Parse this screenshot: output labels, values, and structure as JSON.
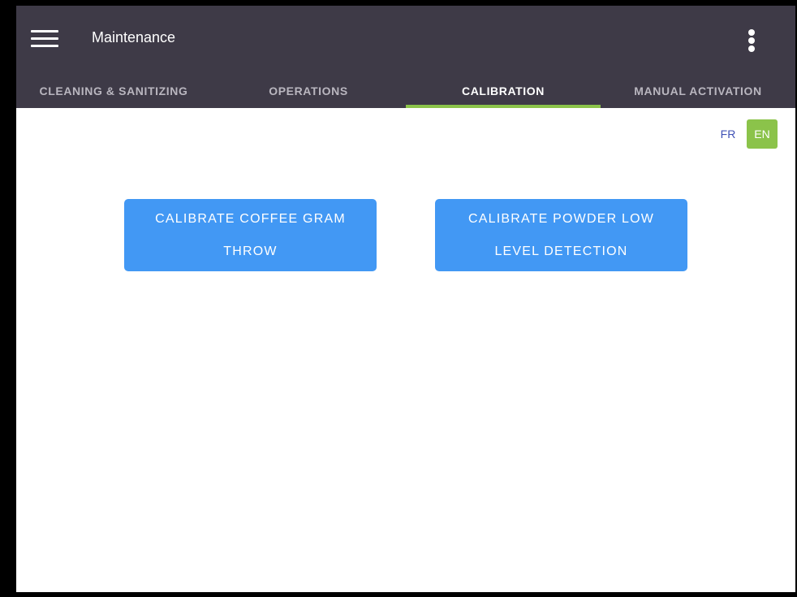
{
  "app": {
    "title": "Maintenance"
  },
  "tabs": [
    {
      "label": "CLEANING & SANITIZING",
      "active": false
    },
    {
      "label": "OPERATIONS",
      "active": false
    },
    {
      "label": "CALIBRATION",
      "active": true
    },
    {
      "label": "MANUAL ACTIVATION",
      "active": false
    }
  ],
  "language": {
    "fr": "FR",
    "en": "EN",
    "selected": "EN"
  },
  "actions": {
    "calibrate_coffee": "CALIBRATE COFFEE GRAM THROW",
    "calibrate_powder": "CALIBRATE POWDER LOW LEVEL DETECTION"
  },
  "colors": {
    "appbar": "#3e3a47",
    "accent": "#8bc34a",
    "button": "#4298f4",
    "lang_link": "#3f51b5"
  },
  "icons": {
    "menu": "hamburger-menu-icon",
    "more": "more-vertical-icon"
  }
}
